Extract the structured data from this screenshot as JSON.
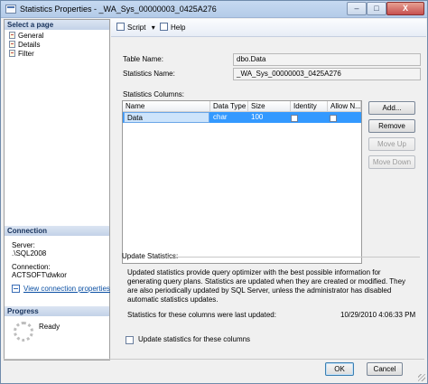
{
  "window": {
    "title": "Statistics Properties - _WA_Sys_00000003_0425A276",
    "minimize_glyph": "–",
    "maximize_glyph": "□",
    "close_glyph": "X"
  },
  "left_panel": {
    "select_page_heading": "Select a page",
    "pages": [
      "General",
      "Details",
      "Filter"
    ],
    "connection_heading": "Connection",
    "server_label": "Server:",
    "server_value": ".\\SQL2008",
    "connection_label": "Connection:",
    "connection_value": "ACTSOFT\\dwkor",
    "view_connection_link": "View connection properties",
    "progress_heading": "Progress",
    "progress_status": "Ready"
  },
  "toolbar": {
    "script_label": "Script",
    "script_dropdown_glyph": "▾",
    "help_label": "Help"
  },
  "general": {
    "table_name_label": "Table Name:",
    "table_name_value": "dbo.Data",
    "statistics_name_label": "Statistics Name:",
    "statistics_name_value": "_WA_Sys_00000003_0425A276",
    "statistics_columns_label": "Statistics Columns:",
    "grid": {
      "headers": [
        "Name",
        "Data Type",
        "Size",
        "Identity",
        "Allow N..."
      ],
      "rows": [
        {
          "name": "Data",
          "data_type": "char",
          "size": "100",
          "identity": false,
          "allow_nulls": false
        }
      ]
    },
    "buttons": {
      "add": "Add...",
      "remove": "Remove",
      "move_up": "Move Up",
      "move_down": "Move Down"
    },
    "update_statistics_heading": "Update Statistics:",
    "update_statistics_description": "Updated statistics provide query optimizer with the best possible information for generating query plans. Statistics are updated when they are created or modified. They are also periodically updated by SQL Server, unless the administrator has disabled automatic statistics updates.",
    "last_updated_label": "Statistics for these columns were last updated:",
    "last_updated_value": "10/29/2010 4:06:33 PM",
    "update_checkbox_label": "Update statistics for these columns",
    "update_checkbox_checked": false
  },
  "footer": {
    "ok": "OK",
    "cancel": "Cancel"
  }
}
